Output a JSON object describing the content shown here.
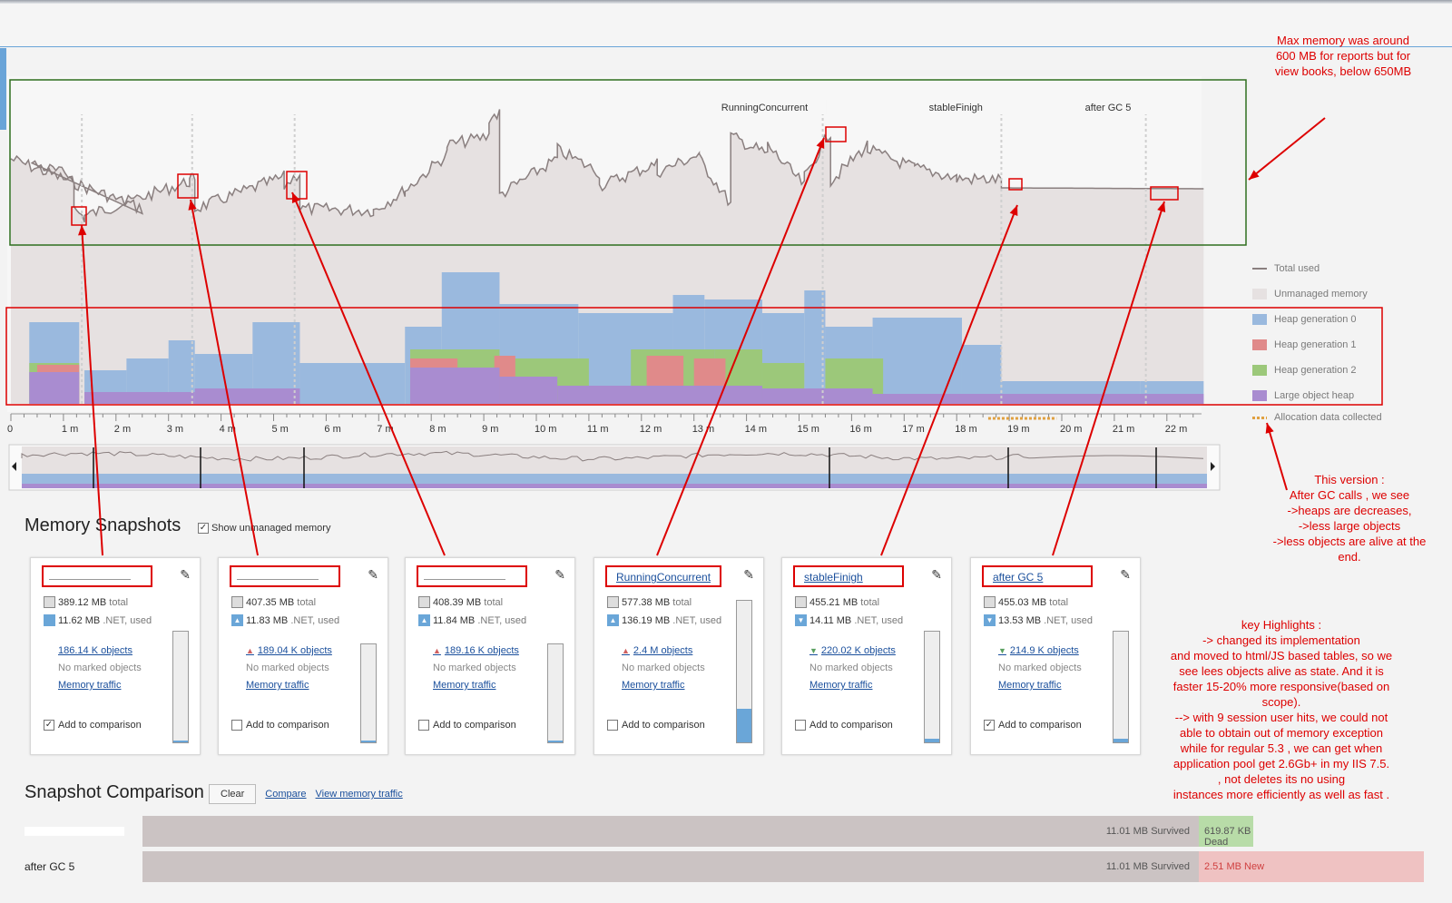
{
  "timeline": {
    "markers": [
      {
        "label": "",
        "minute": 1.35
      },
      {
        "label": "",
        "minute": 3.45
      },
      {
        "label": "",
        "minute": 5.4
      },
      {
        "label": "RunningConcurrent",
        "minute": 15.45
      },
      {
        "label": "stableFinigh",
        "minute": 18.85
      },
      {
        "label": "after GC 5",
        "minute": 21.6
      }
    ],
    "axis_ticks": [
      "0",
      "1 m",
      "2 m",
      "3 m",
      "4 m",
      "5 m",
      "6 m",
      "7 m",
      "8 m",
      "9 m",
      "10 m",
      "11 m",
      "12 m",
      "13 m",
      "14 m",
      "15 m",
      "16 m",
      "17 m",
      "18 m",
      "19 m",
      "20 m",
      "21 m",
      "22 m"
    ]
  },
  "legend": {
    "items": [
      {
        "label": "Total used",
        "color": "#8a7f7f"
      },
      {
        "label": "Unmanaged memory",
        "color": "#e6e1e1"
      },
      {
        "label": "Heap generation 0",
        "color": "#9ab9de"
      },
      {
        "label": "Heap generation 1",
        "color": "#e08a8a"
      },
      {
        "label": "Heap generation 2",
        "color": "#9cc87a"
      },
      {
        "label": "Large object heap",
        "color": "#a98cd0"
      }
    ],
    "allocation_label": "Allocation data collected"
  },
  "snapshots_section": {
    "title": "Memory Snapshots",
    "show_unmanaged_label": "Show unmanaged memory"
  },
  "snapshots": [
    {
      "name": "",
      "total": "389.12 MB",
      "net_used": "11.62 MB",
      "objects": "186.14 K objects",
      "trend": "",
      "add_checked": true,
      "gauge": 0.02
    },
    {
      "name": "",
      "total": "407.35 MB",
      "net_used": "11.83 MB",
      "objects": "189.04 K objects",
      "trend": "up",
      "add_checked": false,
      "gauge": 0.02
    },
    {
      "name": "",
      "total": "408.39 MB",
      "net_used": "11.84 MB",
      "objects": "189.16 K objects",
      "trend": "up",
      "add_checked": false,
      "gauge": 0.02
    },
    {
      "name": "RunningConcurrent",
      "total": "577.38 MB",
      "net_used": "136.19 MB",
      "objects": "2.4 M objects",
      "trend": "up",
      "add_checked": false,
      "gauge": 0.24
    },
    {
      "name": "stableFinigh",
      "total": "455.21 MB",
      "net_used": "14.11 MB",
      "objects": "220.02 K objects",
      "trend": "down",
      "add_checked": false,
      "gauge": 0.03
    },
    {
      "name": "after GC 5",
      "total": "455.03 MB",
      "net_used": "13.53 MB",
      "objects": "214.9 K objects",
      "trend": "down",
      "add_checked": true,
      "gauge": 0.03
    }
  ],
  "snapshot_labels": {
    "total_suffix": "total",
    "net_suffix": ".NET, used",
    "no_marked": "No marked objects",
    "memory_traffic": "Memory traffic",
    "add_to_comparison": "Add to comparison"
  },
  "comparison": {
    "title": "Snapshot Comparison",
    "clear_label": "Clear",
    "compare_label": "Compare",
    "view_traffic_label": "View memory traffic",
    "rows": [
      {
        "label": "",
        "survived": "11.01 MB Survived",
        "extra": "619.87 KB Dead",
        "extra_color": "#b8dca8"
      },
      {
        "label": "after GC 5",
        "survived": "11.01 MB Survived",
        "extra": "2.51 MB New",
        "extra_color": "#efc2c2"
      }
    ]
  },
  "annotations": {
    "max_memory": "Max memory was around 600 MB for reports but for view books, below 650MB",
    "this_version": "This version :\nAfter GC calls , we see\n->heaps are decreases,\n->less large objects\n->less objects are alive at the end.",
    "key_highlights": "key Highlights :\n->               changed its implementation\nand moved to html/JS based tables, so we\nsee lees objects alive as state. And it is\nfaster 15-20% more responsive(based on\nscope).\n--> with 9 session user hits, we could not\nable to obtain out of memory exception\nwhile for regular 5.3 , we can get when\napplication pool get 2.6Gb+ in my IIS 7.5.\n            , not deletes its no using\ninstances more efficiently as well as fast ."
  },
  "colors": {
    "annotation_red": "#dd0000",
    "link_blue": "#1a4f9c",
    "highlight_green_box": "#2f6e1f"
  }
}
